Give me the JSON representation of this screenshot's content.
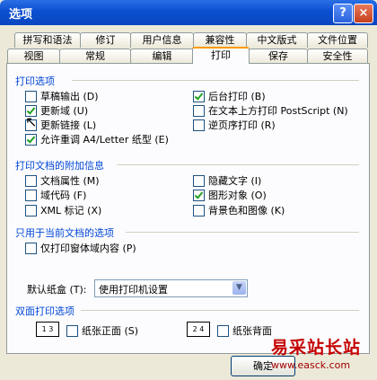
{
  "window": {
    "title": "选项",
    "help": "?",
    "close": "×"
  },
  "tabs_row1": [
    {
      "label": "拼写和语法"
    },
    {
      "label": "修订"
    },
    {
      "label": "用户信息"
    },
    {
      "label": "兼容性"
    },
    {
      "label": "中文版式"
    },
    {
      "label": "文件位置"
    }
  ],
  "tabs_row2": [
    {
      "label": "视图"
    },
    {
      "label": "常规"
    },
    {
      "label": "编辑"
    },
    {
      "label": "打印"
    },
    {
      "label": "保存"
    },
    {
      "label": "安全性"
    }
  ],
  "sections": {
    "print_options": {
      "title": "打印选项",
      "left": [
        {
          "label": "草稿输出 (D)",
          "checked": false
        },
        {
          "label": "更新域 (U)",
          "checked": true
        },
        {
          "label": "更新链接 (L)",
          "checked": false
        },
        {
          "label": "允许重调 A4/Letter 纸型 (E)",
          "checked": true
        }
      ],
      "right": [
        {
          "label": "后台打印 (B)",
          "checked": true
        },
        {
          "label": "在文本上方打印 PostScript (N)",
          "checked": false
        },
        {
          "label": "逆页序打印 (R)",
          "checked": false
        }
      ]
    },
    "doc_info": {
      "title": "打印文档的附加信息",
      "left": [
        {
          "label": "文档属性 (M)",
          "checked": false
        },
        {
          "label": "域代码 (F)",
          "checked": false
        },
        {
          "label": "XML 标记 (X)",
          "checked": false
        }
      ],
      "right": [
        {
          "label": "隐藏文字 (I)",
          "checked": false
        },
        {
          "label": "图形对象 (O)",
          "checked": true
        },
        {
          "label": "背景色和图像 (K)",
          "checked": false
        }
      ]
    },
    "current_doc": {
      "title": "只用于当前文档的选项",
      "items": [
        {
          "label": "仅打印窗体域内容 (P)",
          "checked": false
        }
      ]
    },
    "tray": {
      "label": "默认纸盒 (T):",
      "value": "使用打印机设置"
    },
    "duplex": {
      "title": "双面打印选项",
      "items": [
        {
          "label": "纸张正面 (S)",
          "checked": false,
          "icon": "1 3"
        },
        {
          "label": "纸张背面",
          "checked": false,
          "icon": "2 4"
        }
      ]
    }
  },
  "buttons": {
    "ok": "确定"
  },
  "watermark": {
    "text": "易采站长站",
    "url": "www.easck.com"
  }
}
